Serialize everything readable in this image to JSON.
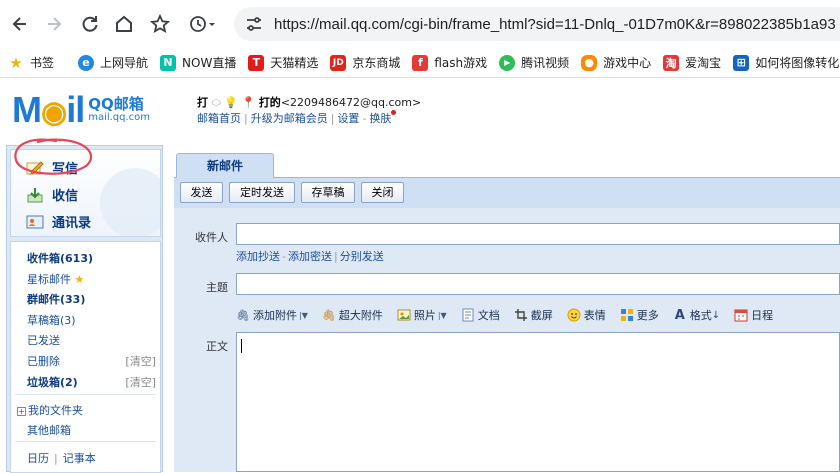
{
  "browser": {
    "url": "https://mail.qq.com/cgi-bin/frame_html?sid=11-Dnlq_-01D7m0K&r=898022385b1a93"
  },
  "bookmarks": [
    {
      "label": "书签",
      "icon": "star-icon",
      "color": "#f4b400"
    },
    {
      "label": "上网导航",
      "icon": "ie-icon",
      "color": "#1e88e5"
    },
    {
      "label": "NOW直播",
      "icon": "now-icon",
      "color": "#00c4a7"
    },
    {
      "label": "天猫精选",
      "icon": "tmall-icon",
      "color": "#e21a1a"
    },
    {
      "label": "京东商城",
      "icon": "jd-icon",
      "color": "#e1251b"
    },
    {
      "label": "flash游戏",
      "icon": "flash-icon",
      "color": "#e53935"
    },
    {
      "label": "腾讯视频",
      "icon": "video-icon",
      "color": "#2ebd59"
    },
    {
      "label": "游戏中心",
      "icon": "gamepad-icon",
      "color": "#ff8a00"
    },
    {
      "label": "爱淘宝",
      "icon": "taobao-icon",
      "color": "#e4393c"
    },
    {
      "label": "如何将图像转化为",
      "icon": "windows-icon",
      "color": "#1565c0"
    }
  ],
  "mail": {
    "logo_main": "M",
    "logo_rest": "il",
    "brand": "QQ邮箱",
    "domain": "mail.qq.com",
    "user_prefix": "打",
    "user_name": "打的",
    "user_email": "<2209486472@qq.com>",
    "links": [
      "邮箱首页",
      "升级为邮箱会员",
      "设置",
      "换肤"
    ]
  },
  "sidebar": {
    "actions": [
      "写信",
      "收信",
      "通讯录"
    ],
    "folders": {
      "inbox": "收件箱(613)",
      "starred": "星标邮件",
      "group": "群邮件(33)",
      "drafts": "草稿箱(3)",
      "sent": "已发送",
      "deleted": "已删除",
      "deleted_clean": "[清空]",
      "spam": "垃圾箱(2)",
      "spam_clean": "[清空]",
      "my_folders": "我的文件夹",
      "other_mail": "其他邮箱",
      "calendar": "日历",
      "notes": "记事本"
    }
  },
  "compose": {
    "tab": "新邮件",
    "buttons": [
      "发送",
      "定时发送",
      "存草稿",
      "关闭"
    ],
    "to_label": "收件人",
    "cc_link": "添加抄送",
    "bcc_link": "添加密送",
    "separate_link": "分别发送",
    "subject_label": "主题",
    "body_label": "正文",
    "tools": {
      "attach": "添加附件",
      "big_attach": "超大附件",
      "photo": "照片",
      "doc": "文档",
      "screenshot": "截屏",
      "emoji": "表情",
      "more": "更多",
      "format": "格式",
      "schedule": "日程"
    }
  },
  "colors": {
    "brand_blue": "#1d7bd6",
    "annotation_red": "#e8455a",
    "panel_blue": "#cfe0f4"
  }
}
